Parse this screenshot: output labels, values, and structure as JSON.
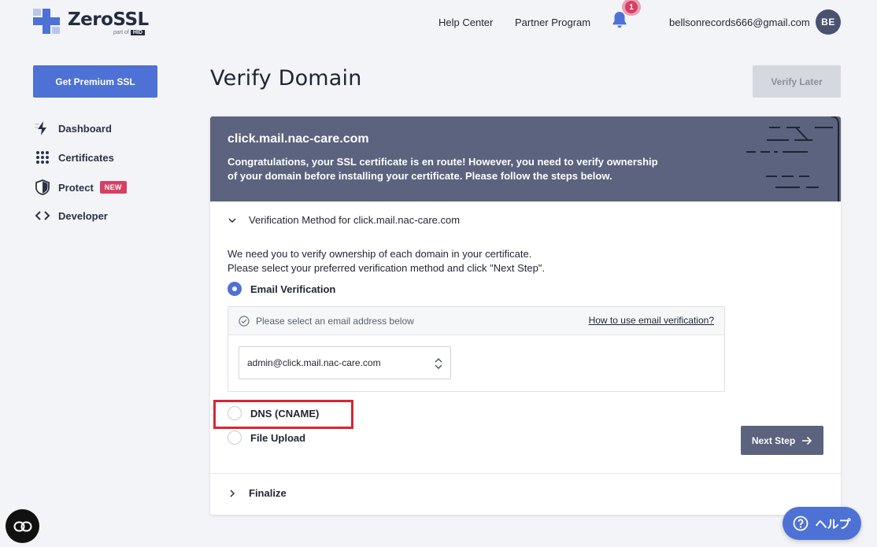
{
  "header": {
    "logo_text": "ZeroSSL",
    "logo_sub": "part of",
    "logo_sub_badge": "HID",
    "links": [
      "Help Center",
      "Partner Program"
    ],
    "notification_count": "1",
    "user_email": "bellsonrecords666@gmail.com",
    "avatar_initials": "BE"
  },
  "sidebar": {
    "premium_button": "Get Premium SSL",
    "items": [
      {
        "label": "Dashboard",
        "icon": "bolt-icon"
      },
      {
        "label": "Certificates",
        "icon": "grid-dots-icon"
      },
      {
        "label": "Protect",
        "icon": "shield-icon",
        "badge": "NEW"
      },
      {
        "label": "Developer",
        "icon": "code-brackets-icon"
      }
    ]
  },
  "page": {
    "title": "Verify Domain",
    "verify_later": "Verify Later"
  },
  "banner": {
    "domain": "click.mail.nac-care.com",
    "message": "Congratulations, your SSL certificate is en route! However, you need to verify ownership of your domain before installing your certificate. Please follow the steps below."
  },
  "verification": {
    "section_title": "Verification Method for click.mail.nac-care.com",
    "description_line1": "We need you to verify ownership of each domain in your certificate.",
    "description_line2": "Please select your preferred verification method and click \"Next Step\".",
    "methods": [
      {
        "label": "Email Verification",
        "selected": true
      },
      {
        "label": "DNS (CNAME)",
        "selected": false
      },
      {
        "label": "File Upload",
        "selected": false
      }
    ],
    "email_hint": "Please select an email address below",
    "email_help_link": "How to use email verification?",
    "email_selected": "admin@click.mail.nac-care.com",
    "next_button": "Next Step"
  },
  "finalize": {
    "label": "Finalize"
  },
  "help_fab": {
    "label": "ヘルプ"
  },
  "colors": {
    "primary": "#4e71d6",
    "banner": "#5b637e",
    "badge": "#d64063",
    "highlight": "#d9252f"
  }
}
